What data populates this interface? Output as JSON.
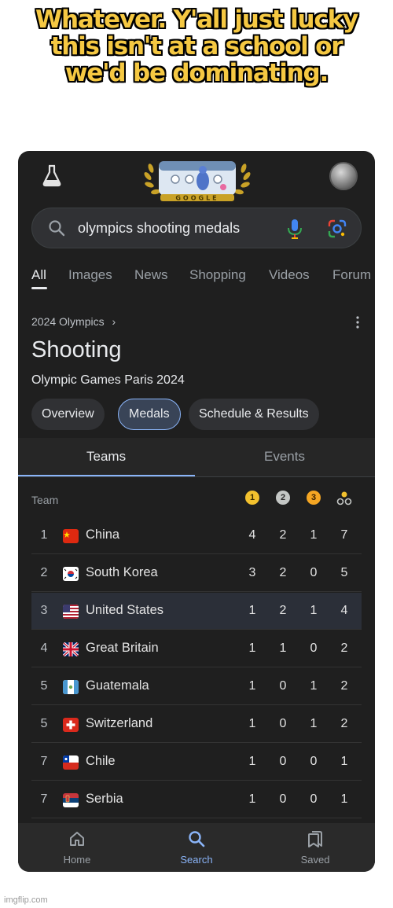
{
  "caption": {
    "line1": "Whatever. Y'all just lucky",
    "line2": "this isn't at a school or",
    "line3": "we'd be dominating."
  },
  "search": {
    "query": "olympics shooting medals",
    "doodle_text": "GOOGLE"
  },
  "tabs": [
    "All",
    "Images",
    "News",
    "Shopping",
    "Videos",
    "Forum"
  ],
  "breadcrumb": "2024 Olympics",
  "title": "Shooting",
  "subtitle": "Olympic Games Paris 2024",
  "chips": [
    "Overview",
    "Medals",
    "Schedule & Results"
  ],
  "subtabs": [
    "Teams",
    "Events"
  ],
  "table": {
    "team_header": "Team",
    "medal_headers": [
      "1",
      "2",
      "3"
    ],
    "rows": [
      {
        "rank": "1",
        "team": "China",
        "gold": "4",
        "silver": "2",
        "bronze": "1",
        "total": "7"
      },
      {
        "rank": "2",
        "team": "South Korea",
        "gold": "3",
        "silver": "2",
        "bronze": "0",
        "total": "5"
      },
      {
        "rank": "3",
        "team": "United States",
        "gold": "1",
        "silver": "2",
        "bronze": "1",
        "total": "4"
      },
      {
        "rank": "4",
        "team": "Great Britain",
        "gold": "1",
        "silver": "1",
        "bronze": "0",
        "total": "2"
      },
      {
        "rank": "5",
        "team": "Guatemala",
        "gold": "1",
        "silver": "0",
        "bronze": "1",
        "total": "2"
      },
      {
        "rank": "5",
        "team": "Switzerland",
        "gold": "1",
        "silver": "0",
        "bronze": "1",
        "total": "2"
      },
      {
        "rank": "7",
        "team": "Chile",
        "gold": "1",
        "silver": "0",
        "bronze": "0",
        "total": "1"
      },
      {
        "rank": "7",
        "team": "Serbia",
        "gold": "1",
        "silver": "0",
        "bronze": "0",
        "total": "1"
      }
    ]
  },
  "bottom_nav": [
    "Home",
    "Search",
    "Saved"
  ],
  "watermark": "imgflip.com",
  "colors": {
    "caption": "#f5c842",
    "background": "#1f1f1f",
    "accent": "#8ab4f8",
    "gold": "#f2c12e",
    "silver": "#c4c7c5",
    "bronze": "#f5a623"
  }
}
